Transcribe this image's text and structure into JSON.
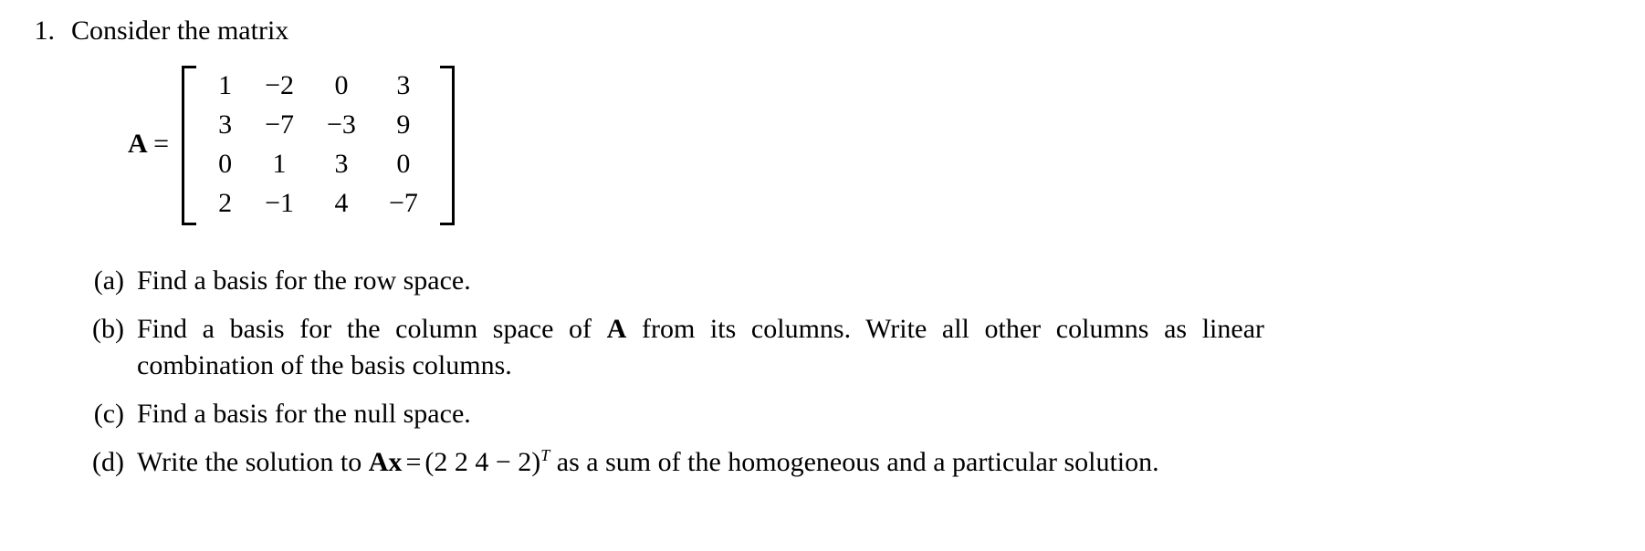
{
  "document": {
    "problem_number": "1.",
    "stem": "Consider the matrix"
  },
  "matrix": {
    "name": "A",
    "equals": "=",
    "rows": [
      [
        "1",
        "−2",
        "0",
        "3"
      ],
      [
        "3",
        "−7",
        "−3",
        "9"
      ],
      [
        "0",
        "1",
        "3",
        "0"
      ],
      [
        "2",
        "−1",
        "4",
        "−7"
      ]
    ],
    "left_bracket": "[",
    "right_bracket": "]"
  },
  "items": [
    {
      "label": "(a)",
      "text": "Find a basis for the row space."
    },
    {
      "label": "(b)",
      "text_before_symbol": "Find a basis for the column space of ",
      "symbol": "A",
      "text_after_symbol": " from its columns. Write all other columns as linear combination of the basis columns."
    },
    {
      "label": "(c)",
      "text": "Find a basis for the null space."
    },
    {
      "label": "(d)",
      "text_before_symbol": "Write the solution to ",
      "symbol": "Ax",
      "equals": "=",
      "vector_open": "(",
      "vector_entries": "2  2  4   − 2",
      "vector_close": ")",
      "transpose": "T",
      "text_after_symbol": " as a sum of the homogeneous and a particular solution."
    }
  ]
}
